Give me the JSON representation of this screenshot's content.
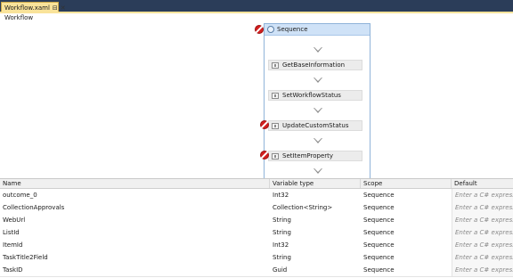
{
  "tab": {
    "title": "Workflow.xaml",
    "pin_glyph": "⊟",
    "close_glyph": "✕"
  },
  "designer": {
    "breadcrumb": "Workflow",
    "sequence_title": "Sequence",
    "activities": [
      {
        "label": "GetBaseInformation",
        "error": false
      },
      {
        "label": "SetWorkflowStatus",
        "error": false
      },
      {
        "label": "UpdateCustomStatus",
        "error": true
      },
      {
        "label": "SetItemProperty",
        "error": true
      }
    ],
    "sequence_error": true
  },
  "variables": {
    "columns": {
      "name": "Name",
      "type": "Variable type",
      "scope": "Scope",
      "default": "Default"
    },
    "rows": [
      {
        "name": "outcome_0",
        "type": "Int32",
        "scope": "Sequence",
        "default": "Enter a C# expression"
      },
      {
        "name": "CollectionApprovals",
        "type": "Collection<String>",
        "scope": "Sequence",
        "default": "Enter a C# expression"
      },
      {
        "name": "WebUrl",
        "type": "String",
        "scope": "Sequence",
        "default": "Enter a C# expression"
      },
      {
        "name": "ListId",
        "type": "String",
        "scope": "Sequence",
        "default": "Enter a C# expression"
      },
      {
        "name": "ItemId",
        "type": "Int32",
        "scope": "Sequence",
        "default": "Enter a C# expression"
      },
      {
        "name": "TaskTitle2Field",
        "type": "String",
        "scope": "Sequence",
        "default": "Enter a C# expression"
      },
      {
        "name": "TaskID",
        "type": "Guid",
        "scope": "Sequence",
        "default": "Enter a C# expression"
      }
    ]
  }
}
